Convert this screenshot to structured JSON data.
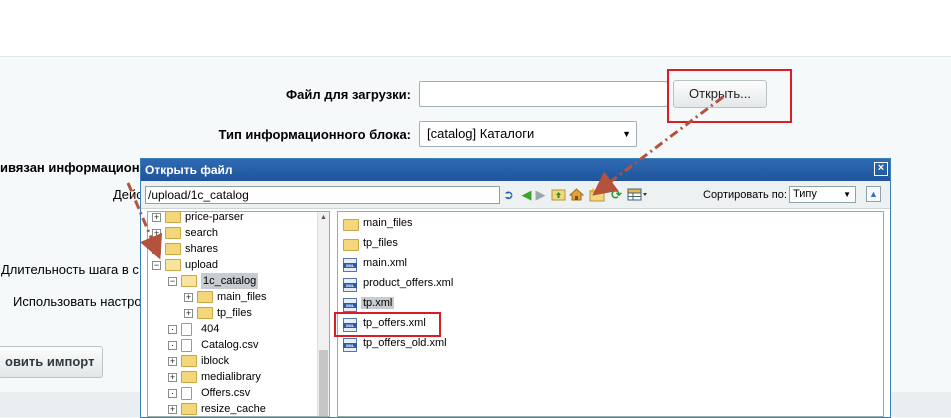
{
  "form": {
    "file_label": "Файл для загрузки:",
    "file_value": "",
    "open_button": "Открыть...",
    "iblock_type_label": "Тип информационного блока:",
    "iblock_type_value": "[catalog] Каталоги",
    "bound_label_partial": "ивязан информацион",
    "action_label_partial": "Дейс",
    "step_label_partial": "Длительность шага в с",
    "use_label_partial": "Использовать настро",
    "import_button_partial": "овить импорт"
  },
  "dialog": {
    "title": "Открыть файл",
    "close_glyph": "×",
    "path": "/upload/1c_catalog",
    "sort_label": "Сортировать по:",
    "sort_value": "Типу",
    "tree": [
      {
        "label": "price-parser",
        "pm": "+"
      },
      {
        "label": "search",
        "pm": "+"
      },
      {
        "label": "shares",
        "pm": "+"
      },
      {
        "label": "upload",
        "pm": "−"
      },
      {
        "label": "1c_catalog",
        "pm": "−"
      },
      {
        "label": "main_files",
        "pm": "+"
      },
      {
        "label": "tp_files",
        "pm": "+"
      },
      {
        "label": "404",
        "pm": "·"
      },
      {
        "label": "Catalog.csv",
        "pm": "·"
      },
      {
        "label": "iblock",
        "pm": "+"
      },
      {
        "label": "medialibrary",
        "pm": "+"
      },
      {
        "label": "Offers.csv",
        "pm": "·"
      },
      {
        "label": "resize_cache",
        "pm": "+"
      }
    ],
    "files": [
      {
        "label": "main_files",
        "type": "folder"
      },
      {
        "label": "tp_files",
        "type": "folder"
      },
      {
        "label": "main.xml",
        "type": "xml"
      },
      {
        "label": "product_offers.xml",
        "type": "xml"
      },
      {
        "label": "tp.xml",
        "type": "xml"
      },
      {
        "label": "tp_offers.xml",
        "type": "xml"
      },
      {
        "label": "tp_offers_old.xml",
        "type": "xml"
      }
    ],
    "xml_badge": "XML",
    "toolbar_icons": [
      "go-icon",
      "back-icon",
      "forward-icon",
      "up-folder-icon",
      "home-icon",
      "new-folder-icon",
      "refresh-icon",
      "view-icon"
    ]
  },
  "colors": {
    "highlight_red": "#d81e24",
    "dialog_title_bg": "#2e6ab3",
    "arrow_color": "#b5523e"
  }
}
